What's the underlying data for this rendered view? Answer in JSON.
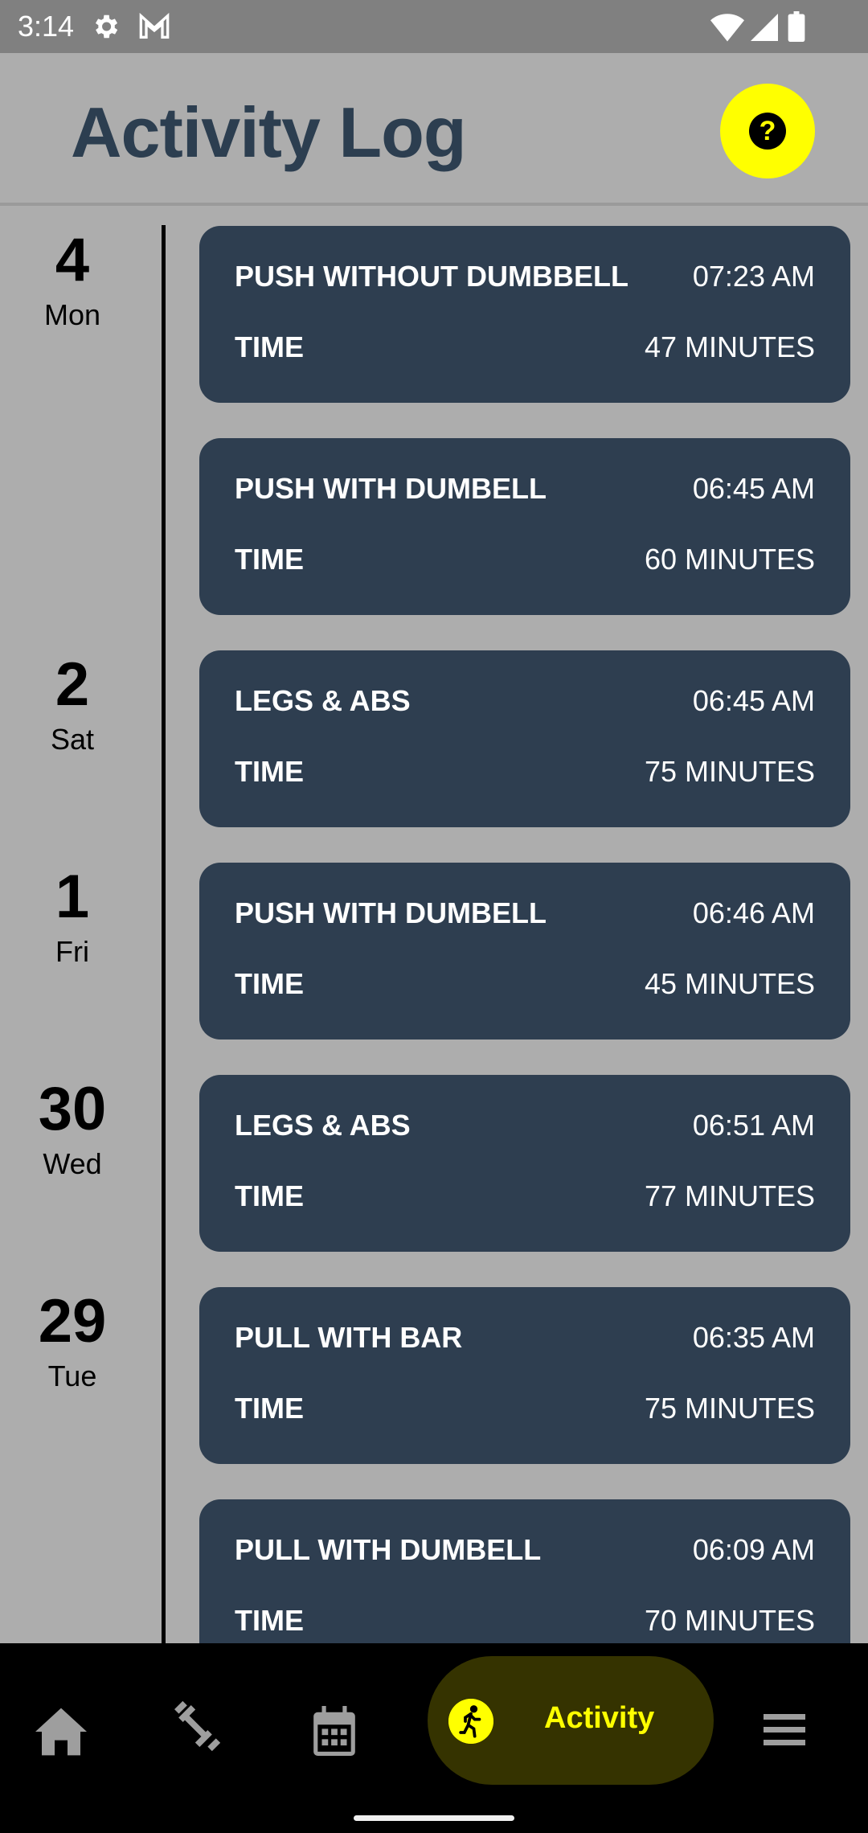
{
  "status_bar": {
    "time": "3:14",
    "icons": [
      "gear-icon",
      "gmail-icon",
      "wifi-icon",
      "signal-icon",
      "battery-icon"
    ]
  },
  "header": {
    "title": "Activity Log",
    "help_button_glyph": "?"
  },
  "colors": {
    "background": "#adadad",
    "card": "#2e3e50",
    "title": "#2c3e50",
    "accent": "#ffff00",
    "nav_bg": "#000000",
    "nav_active_bg": "#353300"
  },
  "days": [
    {
      "num": "4",
      "dow": "Mon"
    },
    {
      "num": "2",
      "dow": "Sat"
    },
    {
      "num": "1",
      "dow": "Fri"
    },
    {
      "num": "30",
      "dow": "Wed"
    },
    {
      "num": "29",
      "dow": "Tue"
    }
  ],
  "activities": [
    {
      "name": "PUSH WITHOUT DUMBBELL",
      "clock": "07:23 AM",
      "label": "TIME",
      "duration": "47 MINUTES"
    },
    {
      "name": "PUSH WITH DUMBELL",
      "clock": "06:45 AM",
      "label": "TIME",
      "duration": "60 MINUTES"
    },
    {
      "name": "LEGS & ABS",
      "clock": "06:45 AM",
      "label": "TIME",
      "duration": "75 MINUTES"
    },
    {
      "name": "PUSH WITH DUMBELL",
      "clock": "06:46 AM",
      "label": "TIME",
      "duration": "45 MINUTES"
    },
    {
      "name": "LEGS & ABS",
      "clock": "06:51 AM",
      "label": "TIME",
      "duration": "77 MINUTES"
    },
    {
      "name": "PULL WITH BAR",
      "clock": "06:35 AM",
      "label": "TIME",
      "duration": "75 MINUTES"
    },
    {
      "name": "PULL WITH DUMBELL",
      "clock": "06:09 AM",
      "label": "TIME",
      "duration": "70 MINUTES"
    }
  ],
  "bottom_nav": {
    "items": [
      {
        "icon": "home-icon",
        "label": ""
      },
      {
        "icon": "dumbbell-icon",
        "label": ""
      },
      {
        "icon": "calendar-icon",
        "label": ""
      },
      {
        "icon": "running-icon",
        "label": "Activity",
        "active": true
      },
      {
        "icon": "menu-icon",
        "label": ""
      }
    ],
    "active_label": "Activity"
  }
}
